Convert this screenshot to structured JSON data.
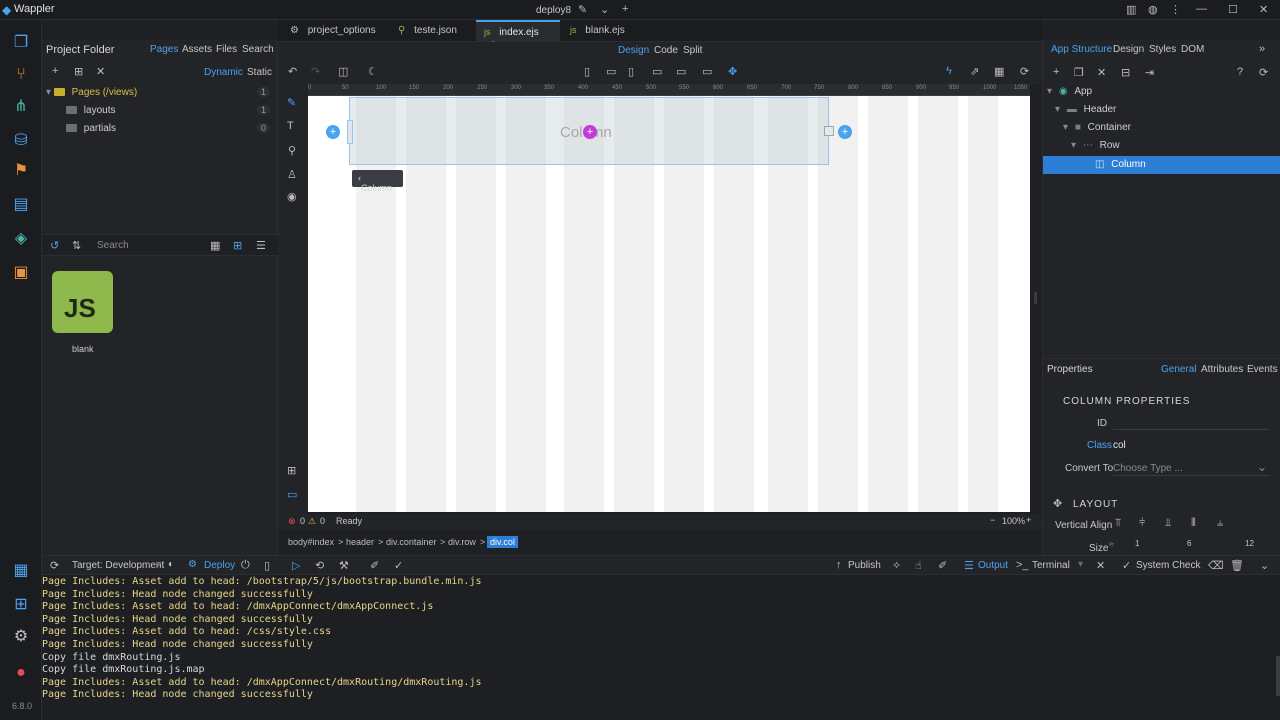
{
  "titlebar": {
    "app_name": "Wappler",
    "project": "deploy8"
  },
  "left_panel": {
    "title": "Project Folder",
    "tabs": [
      "Pages",
      "Assets",
      "Files",
      "Search"
    ],
    "mode_dynamic": "Dynamic",
    "mode_static": "Static",
    "tree": [
      {
        "label": "Pages (/views)",
        "count": "1"
      },
      {
        "label": "layouts",
        "count": "1"
      },
      {
        "label": "partials",
        "count": "0"
      }
    ],
    "search_placeholder": "Search",
    "file": {
      "icon_text": "JS",
      "name": "blank"
    }
  },
  "editor_tabs": [
    {
      "label": "project_options"
    },
    {
      "label": "teste.json"
    },
    {
      "label": "index.ejs"
    },
    {
      "label": "blank.ejs"
    }
  ],
  "view_tabs": {
    "design": "Design",
    "code": "Code",
    "split": "Split"
  },
  "ruler_ticks": [
    "0",
    "50",
    "100",
    "150",
    "200",
    "250",
    "300",
    "350",
    "400",
    "450",
    "500",
    "550",
    "600",
    "650",
    "700",
    "750",
    "800",
    "850",
    "900",
    "950",
    "1000",
    "1050"
  ],
  "canvas": {
    "column_text": "Column",
    "column_tag": "Column"
  },
  "status": {
    "errors": "0",
    "warnings": "0",
    "state": "Ready",
    "zoom": "100%"
  },
  "breadcrumb": [
    "body#index",
    "header",
    "div.container",
    "div.row",
    "div.col"
  ],
  "right_panel": {
    "tabs": [
      "App Structure",
      "Design",
      "Styles",
      "DOM"
    ],
    "tree": [
      {
        "label": "App",
        "level": 0
      },
      {
        "label": "Header",
        "level": 1
      },
      {
        "label": "Container",
        "level": 2
      },
      {
        "label": "Row",
        "level": 3
      },
      {
        "label": "Column",
        "level": 4
      }
    ],
    "properties_title": "Properties",
    "props_tabs": [
      "General",
      "Attributes",
      "Events"
    ],
    "section_title": "COLUMN PROPERTIES",
    "id_label": "ID",
    "class_label": "Class",
    "class_value": "col",
    "convert_label": "Convert To",
    "convert_placeholder": "Choose Type ...",
    "layout_title": "LAYOUT",
    "valign_label": "Vertical Align",
    "size_label": "Size",
    "size_ticks": [
      "1",
      "6",
      "12"
    ]
  },
  "bottom_bar": {
    "target": "Target: Development",
    "deploy": "Deploy",
    "publish": "Publish",
    "output": "Output",
    "terminal": "Terminal",
    "system_check": "System Check"
  },
  "console_lines": [
    {
      "text": "Page Includes: Asset add to head: /bootstrap/5/js/bootstrap.bundle.min.js",
      "c": "y"
    },
    {
      "text": "Page Includes: Head node changed successfully",
      "c": "y"
    },
    {
      "text": "Page Includes: Asset add to head: /dmxAppConnect/dmxAppConnect.js",
      "c": "y"
    },
    {
      "text": "Page Includes: Head node changed successfully",
      "c": "y"
    },
    {
      "text": "Page Includes: Asset add to head: /css/style.css",
      "c": "y"
    },
    {
      "text": "Page Includes: Head node changed successfully",
      "c": "y"
    },
    {
      "text": "Copy file dmxRouting.js",
      "c": "w"
    },
    {
      "text": "Copy file dmxRouting.js.map",
      "c": "w"
    },
    {
      "text": "Page Includes: Asset add to head: /dmxAppConnect/dmxRouting/dmxRouting.js",
      "c": "y"
    },
    {
      "text": "Page Includes: Head node changed successfully",
      "c": "y"
    }
  ],
  "version": "6.8.0"
}
